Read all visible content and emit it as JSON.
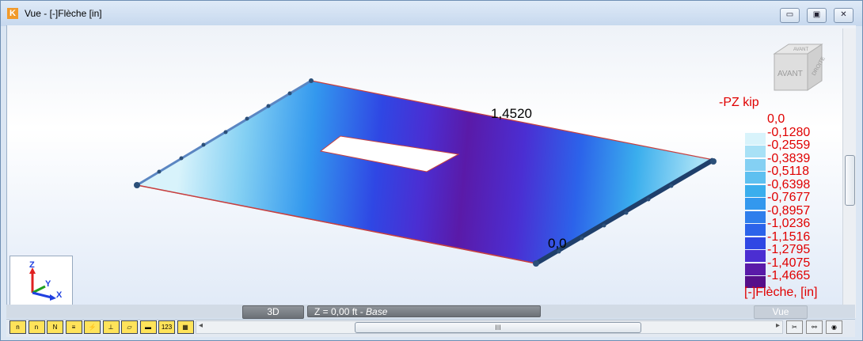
{
  "window": {
    "title": "Vue - [-]Flèche [in]",
    "app_icon": "K",
    "minimize_icon": "▭",
    "restore_icon": "▣",
    "close_icon": "✕"
  },
  "legend": {
    "title": "-PZ kip",
    "unit": "[-]Flèche, [in]",
    "entries": [
      {
        "value": "0,0",
        "color": ""
      },
      {
        "value": "-0,1280",
        "color": "#d8f3fb"
      },
      {
        "value": "-0,2559",
        "color": "#a8e1f6"
      },
      {
        "value": "-0,3839",
        "color": "#84d0f3"
      },
      {
        "value": "-0,5118",
        "color": "#5ec0f0"
      },
      {
        "value": "-0,6398",
        "color": "#3aaeed"
      },
      {
        "value": "-0,7677",
        "color": "#3398ee"
      },
      {
        "value": "-0,8957",
        "color": "#2f7eec"
      },
      {
        "value": "-1,0236",
        "color": "#2c63ea"
      },
      {
        "value": "-1,1516",
        "color": "#2f47e4"
      },
      {
        "value": "-1,2795",
        "color": "#4b2ed2"
      },
      {
        "value": "-1,4075",
        "color": "#5a1aa8"
      },
      {
        "value": "-1,4665",
        "color": "#560f8a"
      }
    ]
  },
  "labels": {
    "max_value": "1,4520",
    "min_value": "0,0"
  },
  "view_cube": {
    "front": "AVANT",
    "right": "DROITE",
    "top": "AVANT"
  },
  "axes": {
    "z": "Z",
    "y": "Y",
    "x": "X"
  },
  "bottom_tabs": {
    "mode": "3D",
    "level": "Z = 0,00 ft",
    "level_name": "Base",
    "view": "Vue"
  },
  "toolbar": {
    "tools": [
      "n",
      "n",
      "N",
      "≡",
      "⚡",
      "⊥",
      "▱",
      "▬",
      "123",
      "▦"
    ],
    "scroll_grip": "III",
    "left_arrow": "◂",
    "right_arrow": "▸"
  },
  "colors": {
    "legend_text": "#e00000",
    "plate_light": "#d8f3fb",
    "plate_dark": "#560f8a",
    "support": "#2b4f79"
  }
}
